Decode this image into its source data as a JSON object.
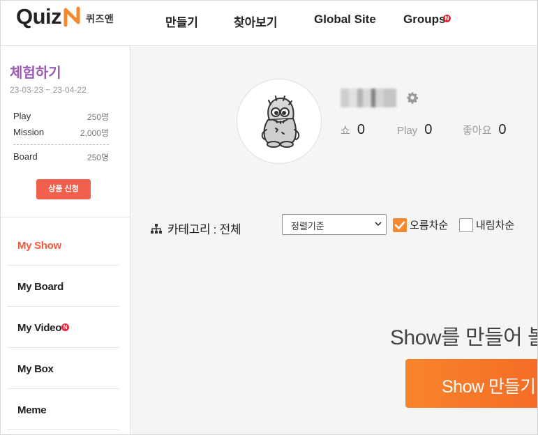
{
  "header": {
    "logo_text": "Quiz",
    "logo_korean": "퀴즈앤",
    "nav": [
      "만들기",
      "찾아보기",
      "Global Site",
      "Groups"
    ],
    "badge_letter": "N"
  },
  "sidebar": {
    "trial_title": "체험하기",
    "trial_dates": "23-03-23 ~ 23-04-22",
    "stats": [
      {
        "label": "Play",
        "value": "250명"
      },
      {
        "label": "Mission",
        "value": "2,000명"
      },
      {
        "label": "Board",
        "value": "250명"
      }
    ],
    "apply_button": "상품 신청",
    "menu": [
      "My Show",
      "My Board",
      "My Video",
      "My Box",
      "Meme"
    ]
  },
  "profile": {
    "stats": [
      {
        "label": "쇼",
        "value": "0"
      },
      {
        "label": "Play",
        "value": "0"
      },
      {
        "label": "좋아요",
        "value": "0"
      }
    ]
  },
  "filters": {
    "category_label": "카테고리 : 전체",
    "sort_selected": "정렬기준",
    "ascending_label": "오름차순",
    "ascending_checked": true,
    "descending_label": "내림차순",
    "descending_checked": false
  },
  "empty": {
    "message": "Show를 만들어 볼",
    "create_button": "Show 만들기"
  },
  "colors": {
    "accent": "#f15a3a",
    "trial": "#9b59b6",
    "orange": "#f5892f"
  }
}
